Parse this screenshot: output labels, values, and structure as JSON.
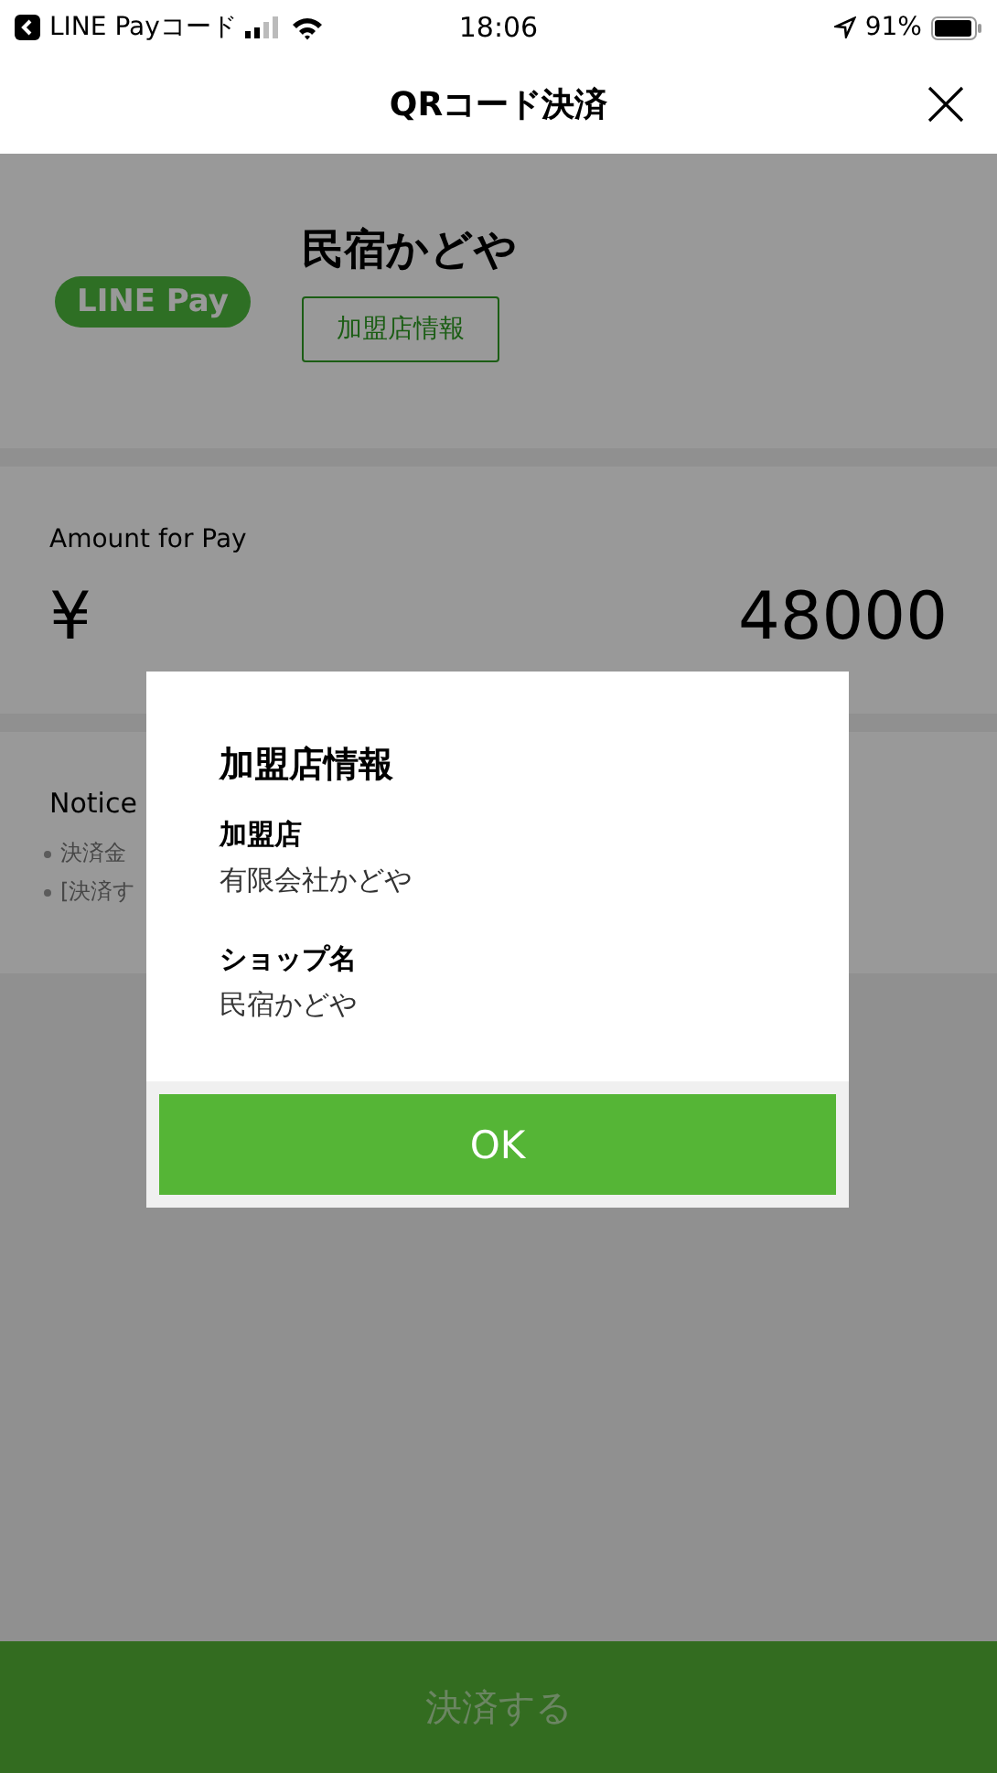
{
  "status_bar": {
    "back_app": "LINE Payコード",
    "time": "18:06",
    "battery": "91%"
  },
  "header": {
    "title": "QRコード決済"
  },
  "merchant": {
    "logo": "LINE Pay",
    "name": "民宿かどや",
    "info_button": "加盟店情報"
  },
  "amount": {
    "label": "Amount for Pay",
    "currency": "¥",
    "value": "48000"
  },
  "notice": {
    "title": "Notice",
    "items": [
      "決済金",
      "[決済す"
    ]
  },
  "dialog": {
    "title": "加盟店情報",
    "fields": [
      {
        "label": "加盟店",
        "value": "有限会社かどや"
      },
      {
        "label": "ショップ名",
        "value": "民宿かどや"
      }
    ],
    "ok": "OK"
  },
  "pay_button": {
    "label": "決済する"
  }
}
